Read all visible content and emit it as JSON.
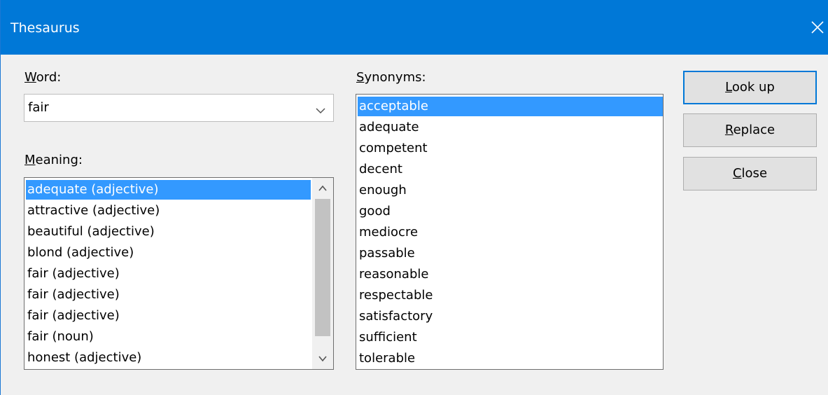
{
  "window": {
    "title": "Thesaurus",
    "close_icon": "close-icon"
  },
  "word": {
    "label_mnemonic": "W",
    "label_rest": "ord:",
    "value": "fair"
  },
  "meaning": {
    "label_mnemonic": "M",
    "label_rest": "eaning:",
    "items": [
      "adequate (adjective)",
      "attractive (adjective)",
      "beautiful (adjective)",
      "blond (adjective)",
      "fair (adjective)",
      "fair (adjective)",
      "fair (adjective)",
      "fair (noun)",
      "honest (adjective)"
    ],
    "selected_index": 0
  },
  "synonyms": {
    "label_mnemonic": "S",
    "label_rest": "ynonyms:",
    "items": [
      "acceptable",
      "adequate",
      "competent",
      "decent",
      "enough",
      "good",
      "mediocre",
      "passable",
      "reasonable",
      "respectable",
      "satisfactory",
      "sufficient",
      "tolerable"
    ],
    "selected_index": 0
  },
  "buttons": {
    "lookup_mnemonic": "L",
    "lookup_rest": "ook up",
    "replace_mnemonic": "R",
    "replace_rest": "eplace",
    "close_mnemonic": "C",
    "close_rest": "lose"
  },
  "colors": {
    "titlebar": "#0078d7",
    "selection": "#3399ff",
    "dialog_bg": "#f0f0f0"
  }
}
